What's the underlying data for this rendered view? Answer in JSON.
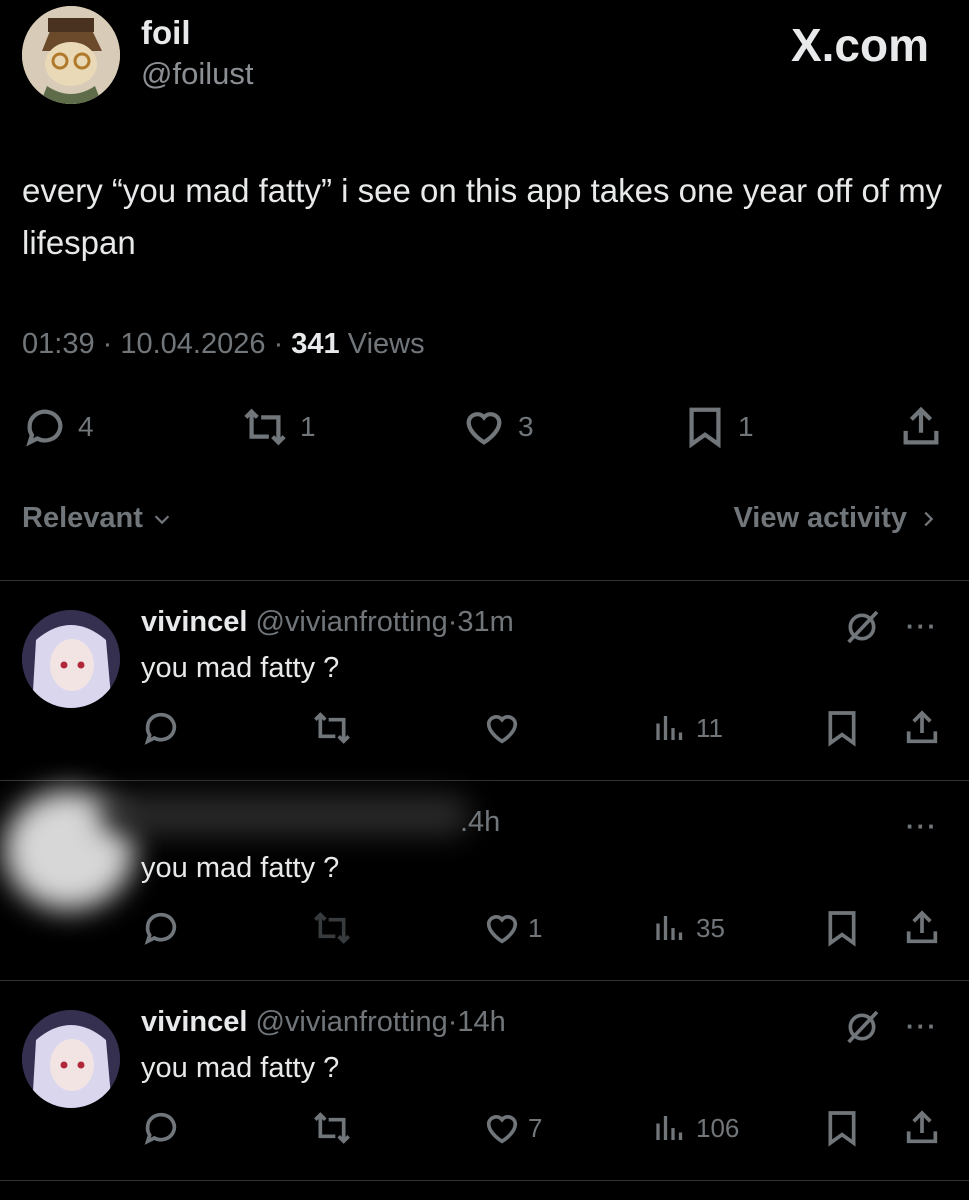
{
  "tweet": {
    "author_name": "foil",
    "author_handle": "@foilust",
    "watermark": "X.com",
    "text": "every “you mad fatty” i see on this app takes one year off of my lifespan",
    "time": "01:39",
    "date": "10.04.2026",
    "views_count": "341",
    "views_label": "Views",
    "replies": "4",
    "reposts": "1",
    "likes": "3",
    "bookmarks": "1"
  },
  "sort": {
    "label": "Relevant",
    "view_activity": "View activity"
  },
  "replies": [
    {
      "name": "vivincel",
      "handle": "@vivianfrotting",
      "dot": "·",
      "time": "31m",
      "text": "you mad fatty ?",
      "likes": "",
      "views": "11"
    },
    {
      "name": "",
      "handle": "",
      "dot": "",
      "time": ".4h",
      "text": "you mad fatty ?",
      "likes": "1",
      "views": "35"
    },
    {
      "name": "vivincel",
      "handle": "@vivianfrotting",
      "dot": "·",
      "time": "14h",
      "text": "you mad fatty ?",
      "likes": "7",
      "views": "106"
    }
  ],
  "icons": {
    "reply": "reply-icon",
    "repost": "repost-icon",
    "like": "heart-icon",
    "bookmark": "bookmark-icon",
    "share": "share-icon",
    "views": "views-bar-icon",
    "grok": "grok-icon",
    "more": "more-icon"
  }
}
